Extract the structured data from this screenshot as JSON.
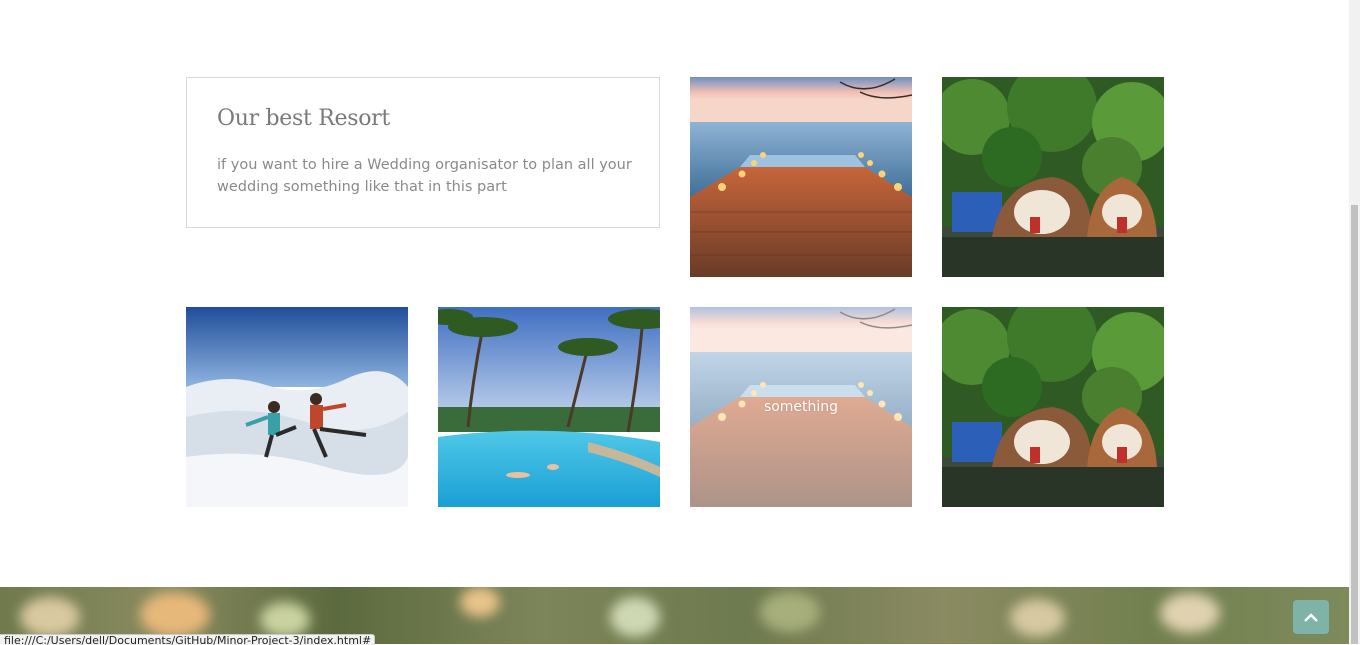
{
  "intro": {
    "title": "Our best Resort",
    "text": "if you want to hire a Wedding organisator to plan all your wedding something like that in this part"
  },
  "gallery": {
    "hover_caption": "something"
  },
  "status_bar": {
    "url": "file:///C:/Users/dell/Documents/GitHub/Minor-Project-3/index.html#"
  },
  "colors": {
    "back_to_top": "#7fb3a8",
    "title_text": "#7a7a7a",
    "body_text": "#8a8a8a"
  },
  "icons": {
    "back_to_top": "chevron-up-icon"
  }
}
